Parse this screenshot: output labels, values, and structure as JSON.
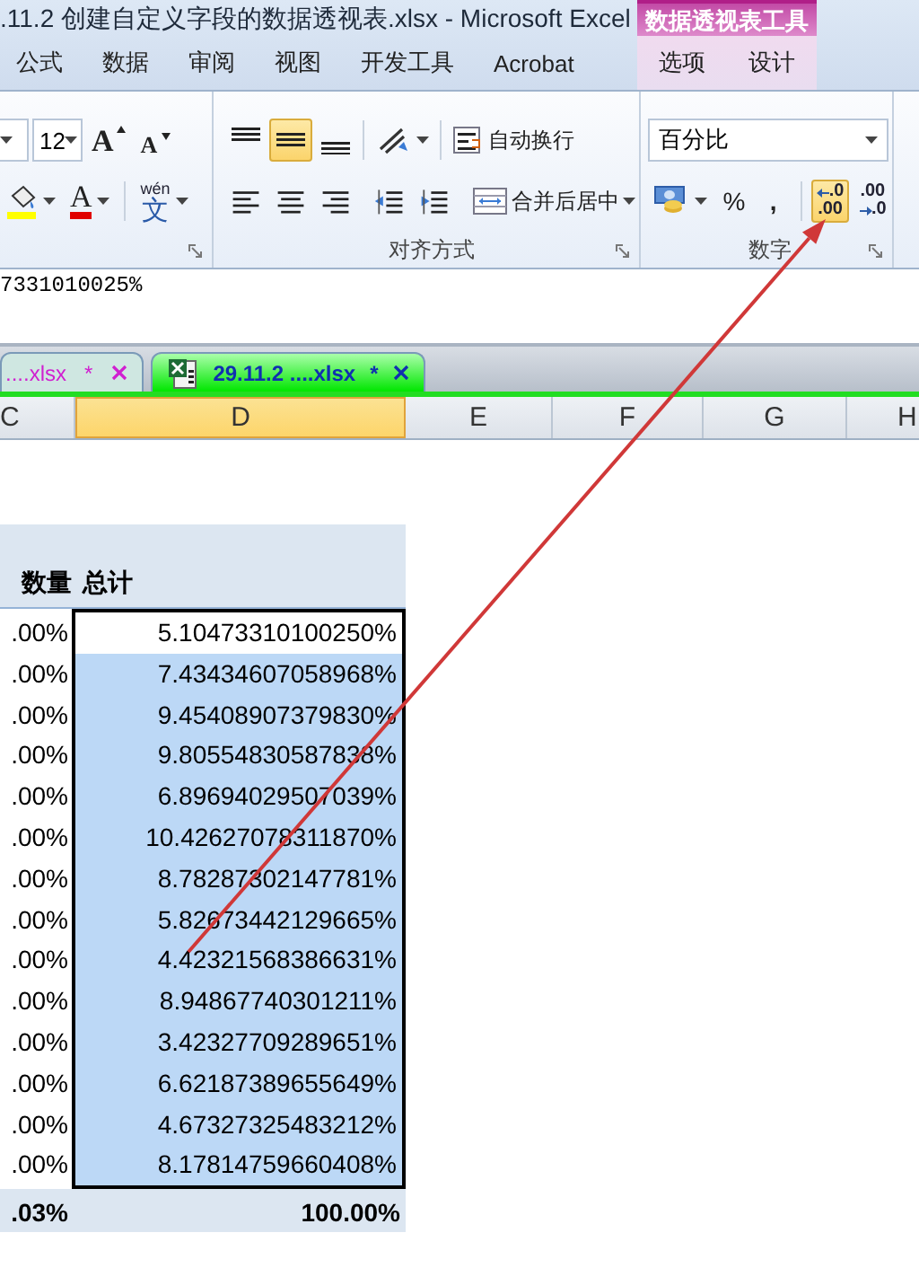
{
  "window": {
    "title": ".11.2 创建自定义字段的数据透视表.xlsx  -  Microsoft Excel"
  },
  "context_group": {
    "title": "数据透视表工具"
  },
  "ribbon_tabs": [
    {
      "label": "公式",
      "context": false
    },
    {
      "label": "数据",
      "context": false
    },
    {
      "label": "审阅",
      "context": false
    },
    {
      "label": "视图",
      "context": false
    },
    {
      "label": "开发工具",
      "context": false
    },
    {
      "label": "Acrobat",
      "context": false
    },
    {
      "label": "选项",
      "context": true
    },
    {
      "label": "设计",
      "context": true
    }
  ],
  "font_group": {
    "size": "12",
    "row1": [
      {
        "kind": "grow",
        "glyph": "A"
      },
      {
        "kind": "shrink",
        "glyph": "A"
      }
    ],
    "row2": [
      {
        "kind": "fill_color"
      },
      {
        "kind": "font_color",
        "glyph": "A"
      },
      {
        "kind": "phonetic",
        "glyphs": [
          "wén",
          "文"
        ]
      }
    ]
  },
  "alignment_group": {
    "label": "对齐方式",
    "vertical": [
      {
        "kind": "top",
        "selected": false
      },
      {
        "kind": "middle",
        "selected": true
      },
      {
        "kind": "bottom",
        "selected": false
      }
    ],
    "horizontal": [
      {
        "kind": "left"
      },
      {
        "kind": "center"
      },
      {
        "kind": "right"
      }
    ],
    "indent": [
      {
        "kind": "decrease"
      },
      {
        "kind": "increase"
      }
    ],
    "wrap_text": "自动换行",
    "merge": "合并后居中"
  },
  "number_group": {
    "label": "数字",
    "format": "百分比",
    "buttons": [
      {
        "kind": "accounting",
        "selected": false
      },
      {
        "kind": "percent",
        "glyph": "%",
        "selected": false
      },
      {
        "kind": "comma",
        "glyph": ",",
        "selected": false
      },
      {
        "kind": "increase_decimal",
        "glyphs": [
          ".0",
          ".00"
        ],
        "selected": true
      },
      {
        "kind": "decrease_decimal",
        "glyphs": [
          ".00",
          ".0"
        ],
        "selected": false
      }
    ]
  },
  "formula_bar": {
    "value": "7331010025%"
  },
  "document_tabs": [
    {
      "label": "....xlsx",
      "modified": "*",
      "selected": false
    },
    {
      "label": "29.11.2 ....xlsx",
      "modified": "*",
      "selected": true
    }
  ],
  "columns": [
    {
      "label": "C",
      "selected": false
    },
    {
      "label": "D",
      "selected": true
    },
    {
      "label": "E",
      "selected": false
    },
    {
      "label": "F",
      "selected": false
    },
    {
      "label": "G",
      "selected": false
    },
    {
      "label": "H",
      "selected": false
    }
  ],
  "pivot": {
    "headers": [
      "数量",
      "总计"
    ],
    "rows": [
      {
        "count": ".00%",
        "total": "5.10473310100250%",
        "selected": false
      },
      {
        "count": ".00%",
        "total": "7.43434607058968%",
        "selected": true
      },
      {
        "count": ".00%",
        "total": "9.45408907379830%",
        "selected": true
      },
      {
        "count": ".00%",
        "total": "9.80554830587838%",
        "selected": true
      },
      {
        "count": ".00%",
        "total": "6.89694029507039%",
        "selected": true
      },
      {
        "count": ".00%",
        "total": "10.42627078311870%",
        "selected": true
      },
      {
        "count": ".00%",
        "total": "8.78287302147781%",
        "selected": true
      },
      {
        "count": ".00%",
        "total": "5.82673442129665%",
        "selected": true
      },
      {
        "count": ".00%",
        "total": "4.42321568386631%",
        "selected": true
      },
      {
        "count": ".00%",
        "total": "8.94867740301211%",
        "selected": true
      },
      {
        "count": ".00%",
        "total": "3.42327709289651%",
        "selected": true
      },
      {
        "count": ".00%",
        "total": "6.62187389655649%",
        "selected": true
      },
      {
        "count": ".00%",
        "total": "4.67327325483212%",
        "selected": true
      },
      {
        "count": ".00%",
        "total": "8.17814759660408%",
        "selected": true
      }
    ],
    "total": {
      "count": ".03%",
      "total": "100.00%"
    }
  }
}
